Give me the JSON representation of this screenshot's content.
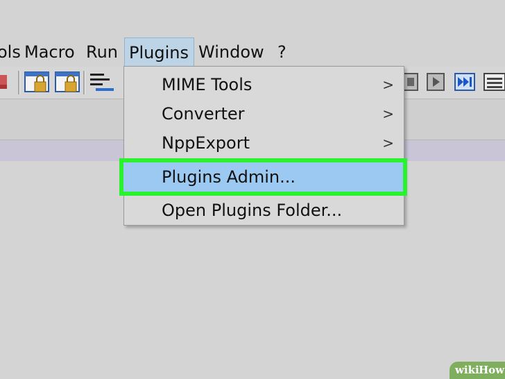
{
  "menubar": {
    "items": [
      {
        "label": "ols"
      },
      {
        "label": "Macro"
      },
      {
        "label": "Run"
      },
      {
        "label": "Plugins"
      },
      {
        "label": "Window"
      },
      {
        "label": "?"
      }
    ]
  },
  "dropdown": {
    "items": [
      {
        "label": "MIME Tools",
        "chevron": ">"
      },
      {
        "label": "Converter",
        "chevron": ">"
      },
      {
        "label": "NppExport",
        "chevron": ">"
      },
      {
        "label": "Plugins Admin..."
      },
      {
        "label": "Open Plugins Folder..."
      }
    ]
  },
  "toolbar": {
    "icons": [
      "view-window-lock-icon",
      "view-window-lock-icon",
      "word-wrap-icon",
      "stop-record-icon",
      "play-macro-icon",
      "run-multiple-macro-icon",
      "save-macro-icon"
    ]
  },
  "colors": {
    "menu_active": "#bcd4e6",
    "highlight_fill": "#9cc9f2",
    "highlight_border": "#2bf22e"
  },
  "watermark": {
    "wiki": "wiki",
    "how": "How"
  }
}
